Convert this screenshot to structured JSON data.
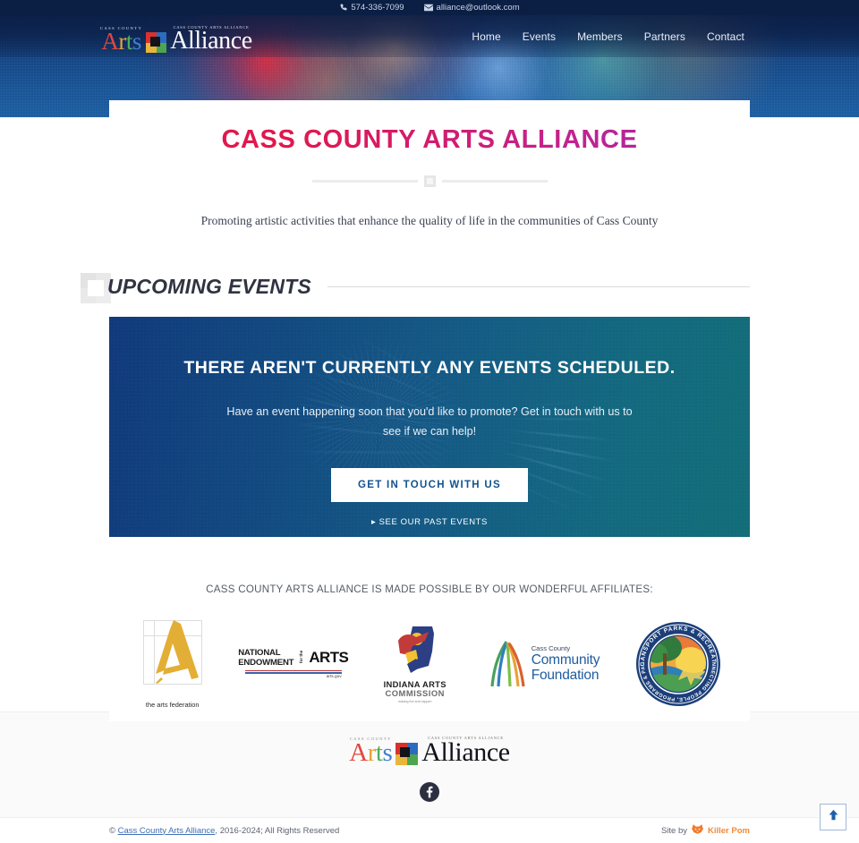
{
  "topbar": {
    "phone": "574-336-7099",
    "email": "alliance@outlook.com",
    "phone_icon": "phone-icon",
    "email_icon": "envelope-icon"
  },
  "logo": {
    "eyebrow": "CASS COUNTY",
    "arts": [
      "A",
      "r",
      "t",
      "s"
    ],
    "tagline": "CASS COUNTY ARTS ALLIANCE",
    "alliance": "Alliance"
  },
  "nav": {
    "items": [
      {
        "label": "Home"
      },
      {
        "label": "Events"
      },
      {
        "label": "Members"
      },
      {
        "label": "Partners"
      },
      {
        "label": "Contact"
      }
    ]
  },
  "hero": {
    "title": "CASS COUNTY ARTS ALLIANCE",
    "tagline": "Promoting artistic activities that enhance the quality of life in the communities of Cass County",
    "title_gradient_start": "#e4174c",
    "title_gradient_end": "#9c2ab0"
  },
  "events_section": {
    "heading": "UPCOMING EVENTS",
    "panel_headline": "THERE AREN'T CURRENTLY ANY EVENTS SCHEDULED.",
    "panel_body": "Have an event happening soon that you'd like to promote? Get in touch with us to see if we can help!",
    "cta_label": "GET IN TOUCH WITH US",
    "past_events_label": "SEE OUR PAST EVENTS",
    "panel_gradient_start": "#10397c",
    "panel_gradient_end": "#126d78",
    "cta_text_color": "#13538f"
  },
  "affiliates": {
    "title": "CASS COUNTY ARTS ALLIANCE IS MADE POSSIBLE BY OUR WONDERFUL AFFILIATES:",
    "logos": [
      {
        "name": "the-arts-federation",
        "caption": "the arts federation"
      },
      {
        "name": "national-endowment-for-the-arts",
        "line1": "NATIONAL",
        "line2": "ENDOWMENT",
        "mid": "for the",
        "big": "ARTS",
        "url_text": "arts.gov"
      },
      {
        "name": "indiana-arts-commission",
        "line1": "INDIANA ARTS",
        "line2": "COMMISSION",
        "line3": "making the arts happen"
      },
      {
        "name": "cass-county-community-foundation",
        "line1": "Cass County",
        "line2": "Community",
        "line3": "Foundation"
      },
      {
        "name": "logansport-parks-and-recreation",
        "top_text": "LOGANSPORT PARKS & RECREATION",
        "bottom_text": "CONNECTING PEOPLE, PROGRAMS & PARKS"
      }
    ]
  },
  "footer": {
    "social": [
      {
        "name": "facebook-icon",
        "label": "Facebook"
      }
    ],
    "copyright_prefix": "©",
    "copyright_link": "Cass County Arts Alliance",
    "copyright_suffix": ", 2016-2024; All Rights Reserved",
    "site_by_label": "Site by",
    "site_by_name": "Killer Pom",
    "site_by_color": "#f08a3c",
    "back_to_top_icon": "arrow-up-icon"
  }
}
